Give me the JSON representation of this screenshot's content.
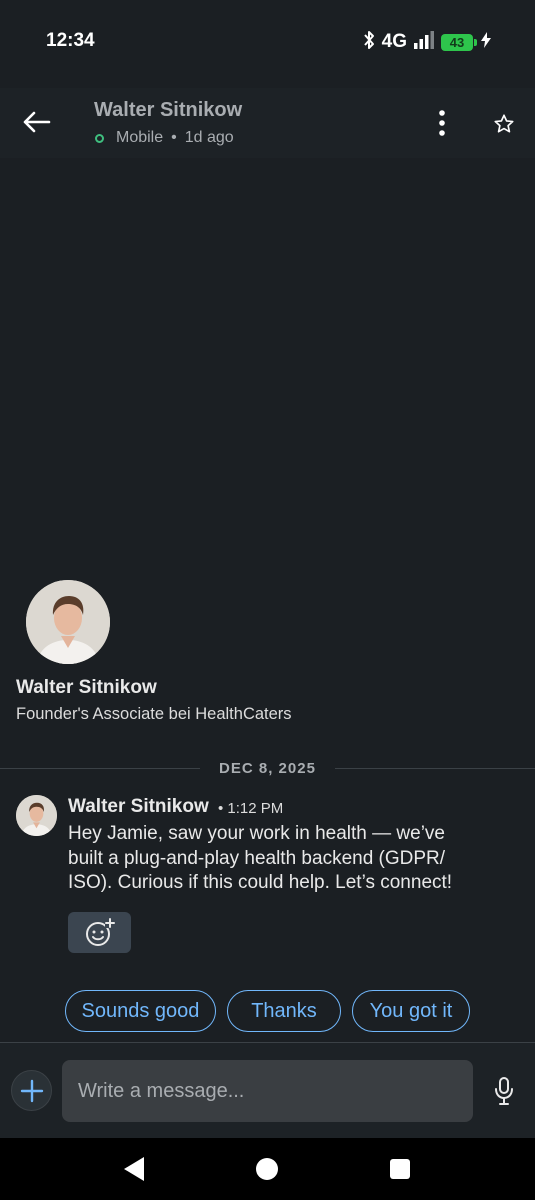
{
  "status_bar": {
    "time": "12:34",
    "network": "4G",
    "battery": "43",
    "icons": [
      "bluetooth-icon",
      "signal-icon",
      "battery-icon",
      "charging-icon"
    ]
  },
  "header": {
    "name": "Walter Sitnikow",
    "presence": "Mobile",
    "last_seen": "1d ago",
    "icons": [
      "back-arrow-icon",
      "more-vertical-icon",
      "star-icon"
    ]
  },
  "profile": {
    "name": "Walter Sitnikow",
    "headline": "Founder's Associate bei HealthCaters"
  },
  "date_divider": "DEC 8, 2025",
  "message": {
    "sender": "Walter Sitnikow",
    "time": "1:12 PM",
    "body_lines": [
      "Hey Jamie, saw your work in health — we’ve",
      "built a plug-and-play health backend (GDPR/",
      "ISO). Curious if this could help. Let’s connect!"
    ]
  },
  "quick_replies": [
    "Sounds good",
    "Thanks",
    "You got it"
  ],
  "composer": {
    "placeholder": "Write a message..."
  },
  "colors": {
    "background": "#1b1f23",
    "accent": "#71b7fb",
    "online": "#3fbf7f",
    "battery": "#2ec54c"
  }
}
